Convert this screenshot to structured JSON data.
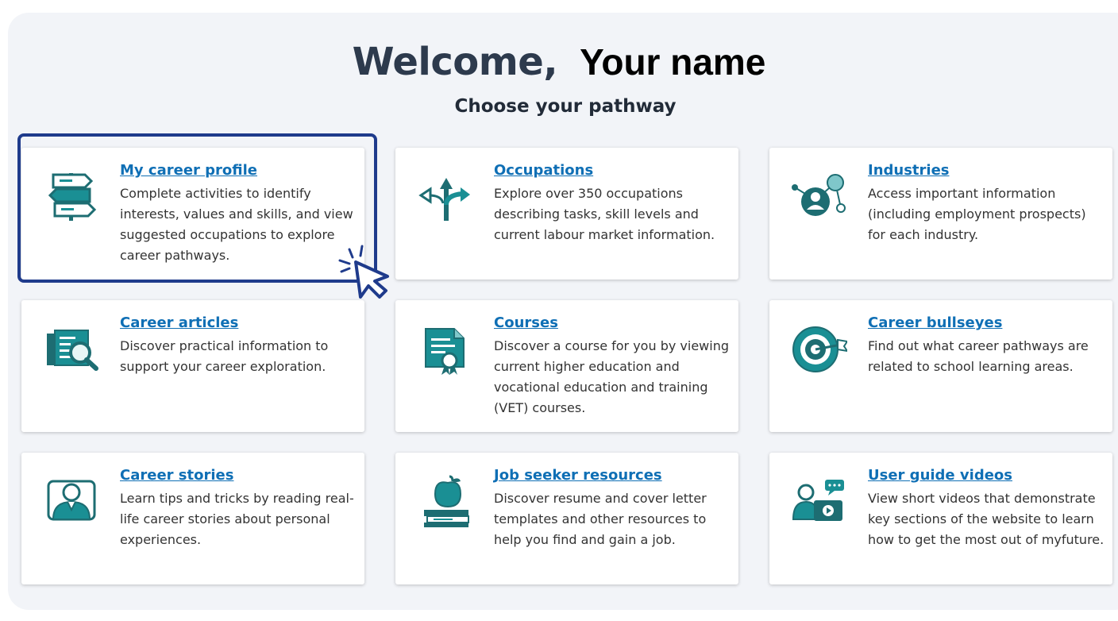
{
  "header": {
    "welcome": "Welcome,",
    "name": "Your name",
    "subtitle": "Choose your pathway"
  },
  "cards": [
    {
      "title": "My career profile",
      "desc": "Complete activities to identify interests, values and skills, and view suggested occupations to explore career pathways.",
      "icon": "signpost-icon"
    },
    {
      "title": "Occupations",
      "desc": "Explore over 350 occupations describing tasks, skill levels and current labour market information.",
      "icon": "split-arrows-icon"
    },
    {
      "title": "Industries",
      "desc": "Access important information (including employment prospects) for each industry.",
      "icon": "network-person-icon"
    },
    {
      "title": "Career articles",
      "desc": "Discover practical information to support your career exploration.",
      "icon": "article-search-icon"
    },
    {
      "title": "Courses",
      "desc": "Discover a course for you by viewing current higher education and vocational education and training (VET) courses.",
      "icon": "certificate-icon"
    },
    {
      "title": "Career bullseyes",
      "desc": "Find out what career pathways are related to school learning areas.",
      "icon": "target-icon"
    },
    {
      "title": "Career stories",
      "desc": "Learn tips and tricks by reading real-life career stories about personal experiences.",
      "icon": "person-frame-icon"
    },
    {
      "title": "Job seeker resources",
      "desc": "Discover resume and cover letter templates and other resources to help you find and gain a job.",
      "icon": "apple-books-icon"
    },
    {
      "title": "User guide videos",
      "desc": "View short videos that demonstrate key sections of the website to learn how to get the most out of myfuture.",
      "icon": "video-presenter-icon"
    }
  ],
  "colors": {
    "accent": "#1a8f94",
    "dark": "#1d6d72",
    "link": "#0f6fb5",
    "selection": "#1f3b8c"
  }
}
